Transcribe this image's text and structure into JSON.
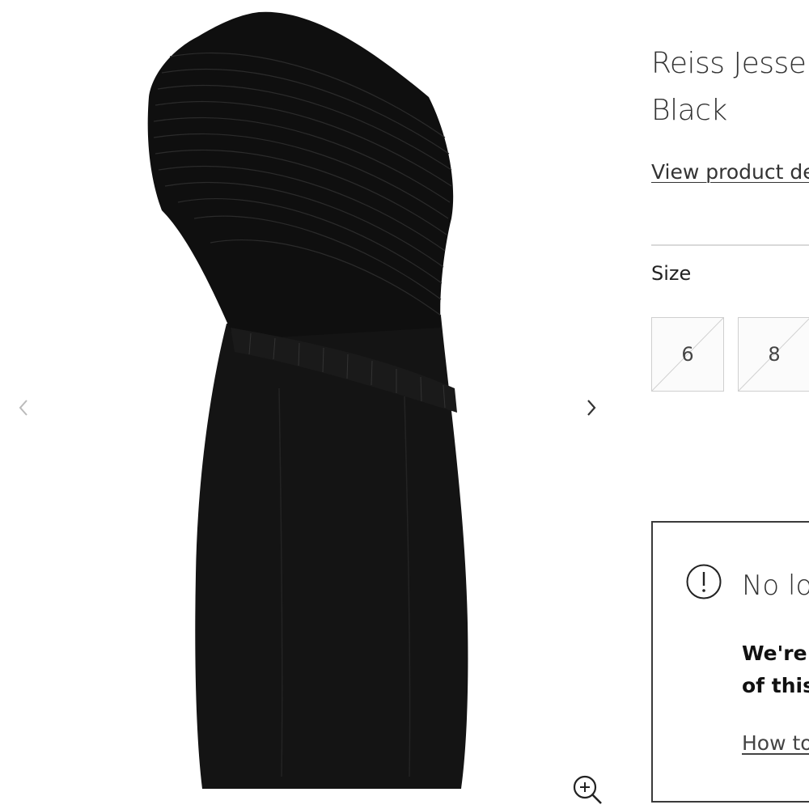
{
  "gallery": {
    "image_alt": "Black one-shoulder pleated dress",
    "prev_icon": "chevron-left-icon",
    "next_icon": "chevron-right-icon",
    "zoom_icon": "zoom-in-icon"
  },
  "product": {
    "title_line1": "Reiss Jesse F",
    "title_line2": "Black",
    "details_link": "View product de"
  },
  "size": {
    "label": "Size",
    "options": [
      {
        "label": "6",
        "available": false
      },
      {
        "label": "8",
        "available": false
      }
    ]
  },
  "notice": {
    "icon": "exclamation-circle-icon",
    "title": "No lo",
    "body_line1": "We're",
    "body_line2": "of this",
    "link": "How to"
  },
  "colors": {
    "text": "#333333",
    "border": "#3a3a3a",
    "divider": "#d9d9d9",
    "dress": "#111111"
  }
}
